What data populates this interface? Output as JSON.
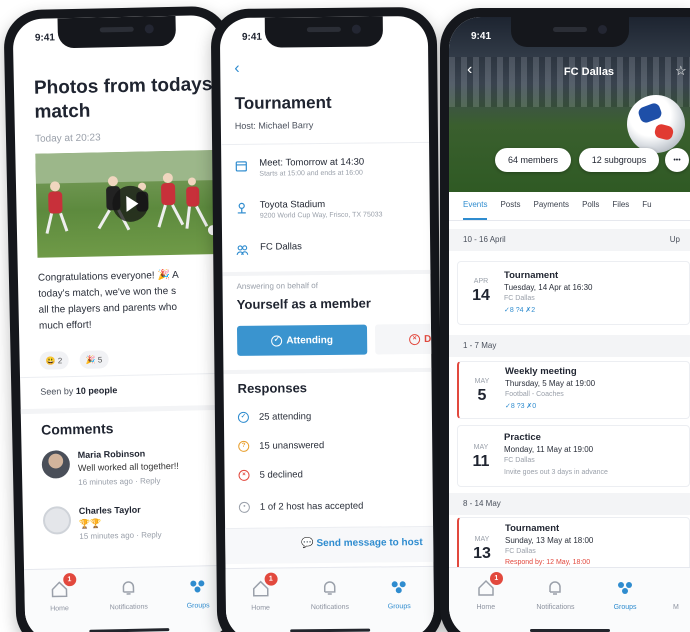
{
  "status_time": "9:41",
  "tabbar": {
    "home": "Home",
    "home_badge": "1",
    "notifications": "Notifications",
    "groups": "Groups",
    "more_partial": "M"
  },
  "post": {
    "title_line1": "Photos from todays",
    "title_line2": "match",
    "date": "Today at 20:23",
    "text_line1": "Congratulations everyone! 🎉 A",
    "text_line2": "today's match, we've won the s",
    "text_line3": "all the players and parents who",
    "text_line4": "much effort!",
    "reaction1": "😃 2",
    "reaction2": "🎉 5",
    "seen_prefix": "Seen by",
    "seen_count": "10 people",
    "comments_header": "Comments",
    "comments": [
      {
        "name": "Maria Robinson",
        "text": "Well worked all together!!",
        "meta": "16 minutes ago · Reply"
      },
      {
        "name": "Charles Taylor",
        "text": "🏆🏆",
        "meta": "15 minutes ago · Reply"
      }
    ]
  },
  "event": {
    "back": "‹",
    "title": "Tournament",
    "host": "Host: Michael Barry",
    "meet_title": "Meet: Tomorrow at 14:30",
    "meet_sub": "Starts at 15:00 and ends at 16:00",
    "venue_title": "Toyota Stadium",
    "venue_sub": "9200 World Cup Way, Frisco, TX 75033",
    "group": "FC Dallas",
    "answering_label": "Answering on behalf of",
    "answering_who": "Yourself as a member",
    "attending_btn": "Attending",
    "decline_btn": "De",
    "responses_header": "Responses",
    "responses": [
      {
        "icon": "✓",
        "text": "25 attending"
      },
      {
        "icon": "?",
        "text": "15 unanswered"
      },
      {
        "icon": "×",
        "text": "5 declined"
      },
      {
        "icon": "•",
        "text": "1 of 2 host has accepted"
      }
    ],
    "send_message": "Send message to host"
  },
  "group": {
    "title": "FC Dallas",
    "members": "64 members",
    "subgroups": "12 subgroups",
    "more": "•••",
    "tabs": [
      "Events",
      "Posts",
      "Payments",
      "Polls",
      "Files",
      "Fu"
    ],
    "sections": [
      {
        "label": "10 - 16 April",
        "right": "Up"
      },
      {
        "label": "1 - 7 May",
        "right": ""
      },
      {
        "label": "8 - 14 May",
        "right": ""
      }
    ],
    "events": [
      {
        "month": "APR",
        "day": "14",
        "title": "Tournament",
        "when": "Tuesday, 14 Apr at 16:30",
        "group": "FC Dallas",
        "stats": "✓8  ?4  ✗2",
        "note": ""
      },
      {
        "month": "MAY",
        "day": "5",
        "title": "Weekly meeting",
        "when": "Thursday, 5 May at 19:00",
        "group": "Football - Coaches",
        "stats": "✓8  ?3  ✗0",
        "note": ""
      },
      {
        "month": "MAY",
        "day": "11",
        "title": "Practice",
        "when": "Monday, 11 May at 19:00",
        "group": "FC Dallas",
        "stats": "",
        "note": "Invite goes out 3 days in advance"
      },
      {
        "month": "MAY",
        "day": "13",
        "title": "Tournament",
        "when": "Sunday, 13 May at 18:00",
        "group": "FC Dallas",
        "stats": "",
        "note": "Respond by: 12 May, 18:00"
      }
    ]
  },
  "colors": {
    "accent": "#2f8ccf",
    "danger": "#e2493e",
    "phone": "#15171c"
  }
}
